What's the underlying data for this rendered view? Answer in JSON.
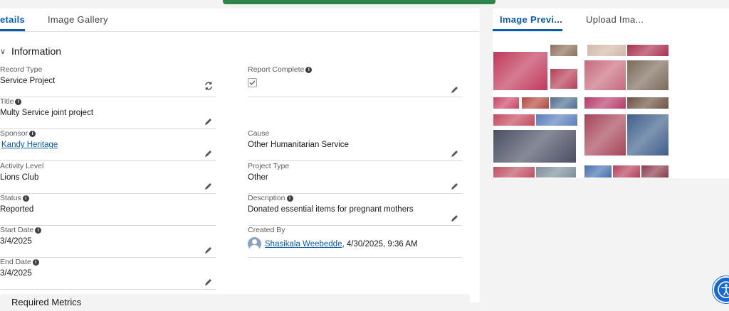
{
  "left_tabs": [
    {
      "label": "etails"
    },
    {
      "label": "Image Gallery"
    }
  ],
  "right_tabs": [
    {
      "label": "Image Previ..."
    },
    {
      "label": "Upload Ima..."
    }
  ],
  "section": {
    "title": "Information",
    "next_title": "Required Metrics"
  },
  "fields": {
    "record_type": {
      "label": "Record Type",
      "value": "Service Project"
    },
    "report_complete": {
      "label": "Report Complete",
      "checked": true
    },
    "title": {
      "label": "Title",
      "value": "Multy Service joint project"
    },
    "sponsor": {
      "label": "Sponsor",
      "value": "Kandy Heritage"
    },
    "cause": {
      "label": "Cause",
      "value": "Other Humanitarian Service"
    },
    "activity_level": {
      "label": "Activity Level",
      "value": "Lions Club"
    },
    "project_type": {
      "label": "Project Type",
      "value": "Other"
    },
    "status": {
      "label": "Status",
      "value": "Reported"
    },
    "description": {
      "label": "Description",
      "value": "Donated essential items for pregnant mothers"
    },
    "start_date": {
      "label": "Start Date",
      "value": "3/4/2025"
    },
    "created_by": {
      "label": "Created By",
      "user": "Shasikala Weebedde",
      "timestamp": ", 4/30/2025, 9:36 AM"
    },
    "end_date": {
      "label": "End Date",
      "value": "3/4/2025"
    }
  },
  "gallery": {
    "photos": [
      {
        "color": "#c0395a"
      },
      {
        "color": "#8c6f5a"
      },
      {
        "color": "#b73c56"
      },
      {
        "color": "#d1b9a6"
      },
      {
        "color": "#c76a7c"
      },
      {
        "color": "#a9314d"
      },
      {
        "color": "#7b6a59"
      },
      {
        "color": "#c84466"
      },
      {
        "color": "#b2493d"
      },
      {
        "color": "#4f6e8f"
      },
      {
        "color": "#b63b6a"
      },
      {
        "color": "#6d5242"
      },
      {
        "color": "#c44a5d"
      },
      {
        "color": "#5a7dbb"
      },
      {
        "color": "#a64558"
      },
      {
        "color": "#3e5f8a"
      },
      {
        "color": "#4b4f63"
      },
      {
        "color": "#bf4f63"
      },
      {
        "color": "#7c8f9b"
      },
      {
        "color": "#456fae"
      },
      {
        "color": "#b4405c"
      },
      {
        "color": "#8a3b4c"
      },
      {
        "color": "#5e6b4c"
      },
      {
        "color": "#2f5f96"
      }
    ]
  },
  "colors": {
    "brand": "#0b5cab",
    "toast": "#2e844a",
    "accessibility": "#1766d3"
  },
  "icons": {
    "info": "info-icon",
    "edit": "pencil-icon",
    "change_record_type": "sync-icon",
    "accessibility": "accessibility-icon"
  }
}
